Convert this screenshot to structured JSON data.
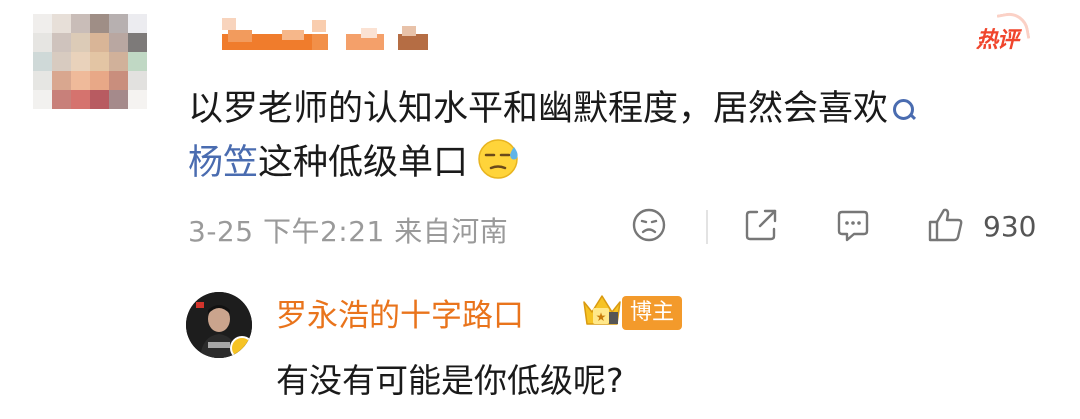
{
  "post": {
    "hot_label": "热评",
    "comment_text": "以罗老师的认知水平和幽默程度，居然会喜欢",
    "comment_link": "杨笠",
    "comment_tail": "这种低级单口",
    "meta": "3-25 下午2:21 来自河南",
    "like_count": "930",
    "icons": [
      "dislike-icon",
      "share-icon",
      "comment-icon",
      "like-icon"
    ]
  },
  "reply": {
    "author": "罗永浩的十字路口",
    "badge_label": "博主",
    "text": "有没有可能是你低级呢?"
  },
  "colors": {
    "link": "#4a6cb0",
    "reply_author": "#e9741c",
    "hot_label": "#f0452c",
    "badge": "#f39a2b"
  }
}
